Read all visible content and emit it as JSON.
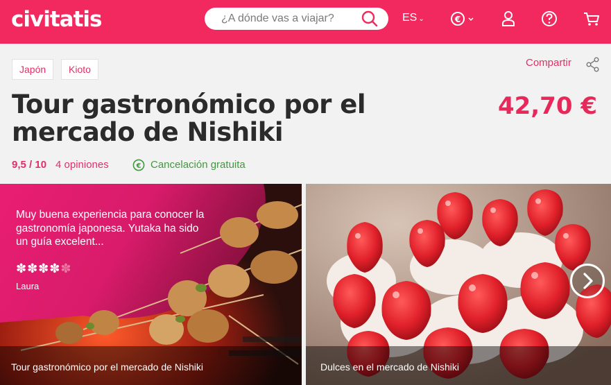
{
  "header": {
    "logo": "civitatis",
    "search_placeholder": "¿A dónde vas a viajar?",
    "language": "ES",
    "currency_icon": "euro-icon",
    "brand_color": "#f2295e"
  },
  "breadcrumbs": [
    "Japón",
    "Kioto"
  ],
  "share_label": "Compartir",
  "tour": {
    "title_line1": "Tour gastronómico por el",
    "title_line2": "mercado de Nishiki",
    "price": "42,70 €",
    "rating": "9,5 / 10",
    "reviews": "4 opiniones",
    "cancellation": "Cancelación gratuita"
  },
  "gallery": {
    "review": {
      "text": "Muy buena experiencia para conocer la gastronomía japonesa. Yutaka ha sido un guía excelent...",
      "stars_filled": 4,
      "stars_total": 5,
      "stars_full": "✽✽✽✽",
      "stars_empty": "✽",
      "author": "Laura"
    },
    "images": [
      {
        "caption": "Tour gastronómico por el mercado de Nishiki"
      },
      {
        "caption": "Dulces en el mercado de Nishiki"
      }
    ]
  }
}
